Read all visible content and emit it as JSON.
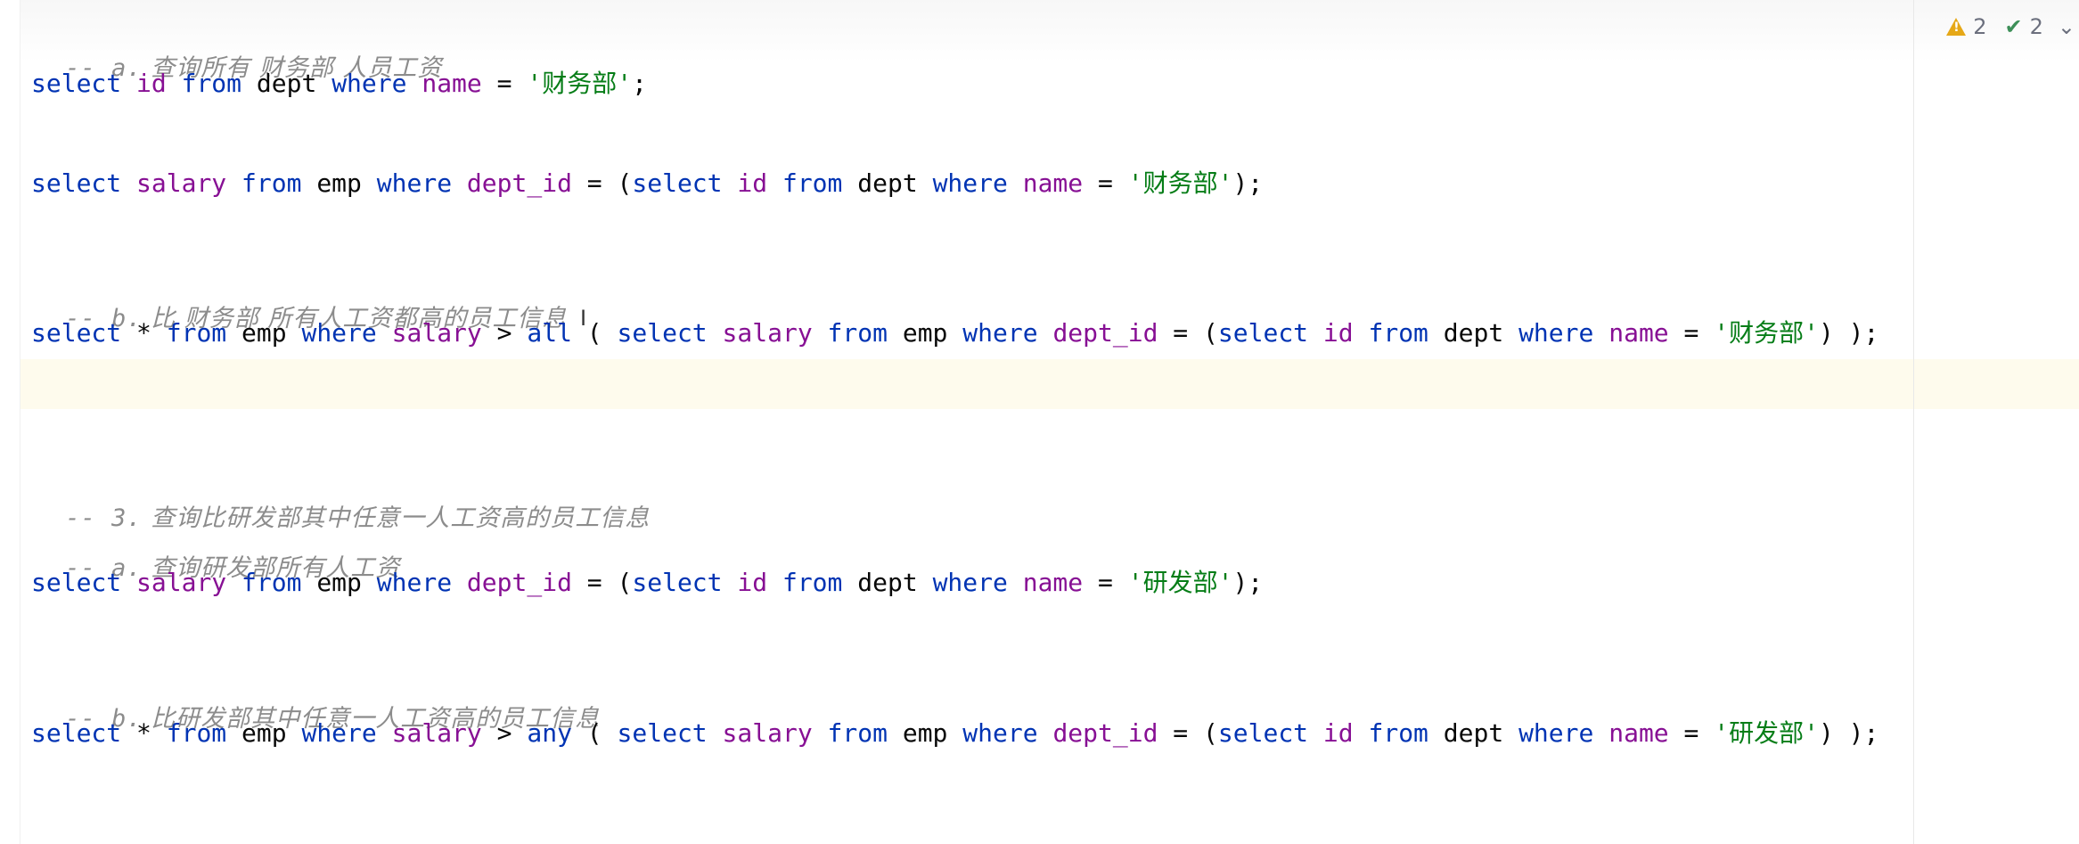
{
  "inspections": {
    "warnings": "2",
    "checks": "2",
    "more": "⌄"
  },
  "lines": [
    {
      "kind": "comment",
      "prefix": "-- a.",
      "text": " 查询所有 财务部 人员工资"
    },
    {
      "kind": "code",
      "tokens": [
        {
          "t": "kw",
          "v": "select"
        },
        {
          "t": "plain",
          "v": " "
        },
        {
          "t": "col",
          "v": "id"
        },
        {
          "t": "plain",
          "v": " "
        },
        {
          "t": "kw",
          "v": "from"
        },
        {
          "t": "plain",
          "v": " dept "
        },
        {
          "t": "kw",
          "v": "where"
        },
        {
          "t": "plain",
          "v": " "
        },
        {
          "t": "col",
          "v": "name"
        },
        {
          "t": "plain",
          "v": " = "
        },
        {
          "t": "str",
          "v": "'财务部'"
        },
        {
          "t": "plain",
          "v": ";"
        }
      ]
    },
    {
      "kind": "code",
      "tokens": [
        {
          "t": "kw",
          "v": "select"
        },
        {
          "t": "plain",
          "v": " "
        },
        {
          "t": "col",
          "v": "salary"
        },
        {
          "t": "plain",
          "v": " "
        },
        {
          "t": "kw",
          "v": "from"
        },
        {
          "t": "plain",
          "v": " emp "
        },
        {
          "t": "kw",
          "v": "where"
        },
        {
          "t": "plain",
          "v": " "
        },
        {
          "t": "col",
          "v": "dept_id"
        },
        {
          "t": "plain",
          "v": " = ("
        },
        {
          "t": "kw",
          "v": "select"
        },
        {
          "t": "plain",
          "v": " "
        },
        {
          "t": "col",
          "v": "id"
        },
        {
          "t": "plain",
          "v": " "
        },
        {
          "t": "kw",
          "v": "from"
        },
        {
          "t": "plain",
          "v": " dept "
        },
        {
          "t": "kw",
          "v": "where"
        },
        {
          "t": "plain",
          "v": " "
        },
        {
          "t": "col",
          "v": "name"
        },
        {
          "t": "plain",
          "v": " = "
        },
        {
          "t": "str",
          "v": "'财务部'"
        },
        {
          "t": "plain",
          "v": ");"
        }
      ]
    },
    {
      "kind": "comment",
      "prefix": "-- b.",
      "text": " 比 财务部 所有人工资都高的员工信息"
    },
    {
      "kind": "code",
      "tokens": [
        {
          "t": "kw",
          "v": "select"
        },
        {
          "t": "plain",
          "v": " * "
        },
        {
          "t": "kw",
          "v": "from"
        },
        {
          "t": "plain",
          "v": " emp "
        },
        {
          "t": "kw",
          "v": "where"
        },
        {
          "t": "plain",
          "v": " "
        },
        {
          "t": "col",
          "v": "salary"
        },
        {
          "t": "plain",
          "v": " > "
        },
        {
          "t": "kw",
          "v": "all"
        },
        {
          "t": "plain",
          "v": " ( "
        },
        {
          "t": "kw",
          "v": "select"
        },
        {
          "t": "plain",
          "v": " "
        },
        {
          "t": "col",
          "v": "salary"
        },
        {
          "t": "plain",
          "v": " "
        },
        {
          "t": "kw",
          "v": "from"
        },
        {
          "t": "plain",
          "v": " emp "
        },
        {
          "t": "kw",
          "v": "where"
        },
        {
          "t": "plain",
          "v": " "
        },
        {
          "t": "col",
          "v": "dept_id"
        },
        {
          "t": "plain",
          "v": " = ("
        },
        {
          "t": "kw",
          "v": "select"
        },
        {
          "t": "plain",
          "v": " "
        },
        {
          "t": "col",
          "v": "id"
        },
        {
          "t": "plain",
          "v": " "
        },
        {
          "t": "kw",
          "v": "from"
        },
        {
          "t": "plain",
          "v": " dept "
        },
        {
          "t": "kw",
          "v": "where"
        },
        {
          "t": "plain",
          "v": " "
        },
        {
          "t": "col",
          "v": "name"
        },
        {
          "t": "plain",
          "v": " = "
        },
        {
          "t": "str",
          "v": "'财务部'"
        },
        {
          "t": "plain",
          "v": ") );"
        }
      ]
    },
    {
      "kind": "comment",
      "prefix": "-- 3.",
      "text": " 查询比研发部其中任意一人工资高的员工信息"
    },
    {
      "kind": "comment",
      "prefix": "-- a.",
      "text": " 查询研发部所有人工资"
    },
    {
      "kind": "code",
      "tokens": [
        {
          "t": "kw",
          "v": "select"
        },
        {
          "t": "plain",
          "v": " "
        },
        {
          "t": "col",
          "v": "salary"
        },
        {
          "t": "plain",
          "v": " "
        },
        {
          "t": "kw",
          "v": "from"
        },
        {
          "t": "plain",
          "v": " emp "
        },
        {
          "t": "kw",
          "v": "where"
        },
        {
          "t": "plain",
          "v": " "
        },
        {
          "t": "col",
          "v": "dept_id"
        },
        {
          "t": "plain",
          "v": " = ("
        },
        {
          "t": "kw",
          "v": "select"
        },
        {
          "t": "plain",
          "v": " "
        },
        {
          "t": "col",
          "v": "id"
        },
        {
          "t": "plain",
          "v": " "
        },
        {
          "t": "kw",
          "v": "from"
        },
        {
          "t": "plain",
          "v": " dept "
        },
        {
          "t": "kw",
          "v": "where"
        },
        {
          "t": "plain",
          "v": " "
        },
        {
          "t": "col",
          "v": "name"
        },
        {
          "t": "plain",
          "v": " = "
        },
        {
          "t": "str",
          "v": "'研发部'"
        },
        {
          "t": "plain",
          "v": ");"
        }
      ]
    },
    {
      "kind": "comment",
      "prefix": "-- b.",
      "text": " 比研发部其中任意一人工资高的员工信息"
    },
    {
      "kind": "code",
      "tokens": [
        {
          "t": "kw",
          "v": "select"
        },
        {
          "t": "plain",
          "v": " * "
        },
        {
          "t": "kw",
          "v": "from"
        },
        {
          "t": "plain",
          "v": " emp "
        },
        {
          "t": "kw",
          "v": "where"
        },
        {
          "t": "plain",
          "v": " "
        },
        {
          "t": "col",
          "v": "salary"
        },
        {
          "t": "plain",
          "v": " > "
        },
        {
          "t": "kw",
          "v": "any"
        },
        {
          "t": "plain",
          "v": " ( "
        },
        {
          "t": "kw",
          "v": "select"
        },
        {
          "t": "plain",
          "v": " "
        },
        {
          "t": "col",
          "v": "salary"
        },
        {
          "t": "plain",
          "v": " "
        },
        {
          "t": "kw",
          "v": "from"
        },
        {
          "t": "plain",
          "v": " emp "
        },
        {
          "t": "kw",
          "v": "where"
        },
        {
          "t": "plain",
          "v": " "
        },
        {
          "t": "col",
          "v": "dept_id"
        },
        {
          "t": "plain",
          "v": " = ("
        },
        {
          "t": "kw",
          "v": "select"
        },
        {
          "t": "plain",
          "v": " "
        },
        {
          "t": "col",
          "v": "id"
        },
        {
          "t": "plain",
          "v": " "
        },
        {
          "t": "kw",
          "v": "from"
        },
        {
          "t": "plain",
          "v": " dept "
        },
        {
          "t": "kw",
          "v": "where"
        },
        {
          "t": "plain",
          "v": " "
        },
        {
          "t": "col",
          "v": "name"
        },
        {
          "t": "plain",
          "v": " = "
        },
        {
          "t": "str",
          "v": "'研发部'"
        },
        {
          "t": "plain",
          "v": ") );"
        }
      ]
    }
  ],
  "colors": {
    "keyword": "#0033b3",
    "column": "#871094",
    "string": "#067d17",
    "comment": "#8c8c8c",
    "caret_line": "#fefbed",
    "warning": "#e6a817",
    "check": "#3d8f58"
  }
}
